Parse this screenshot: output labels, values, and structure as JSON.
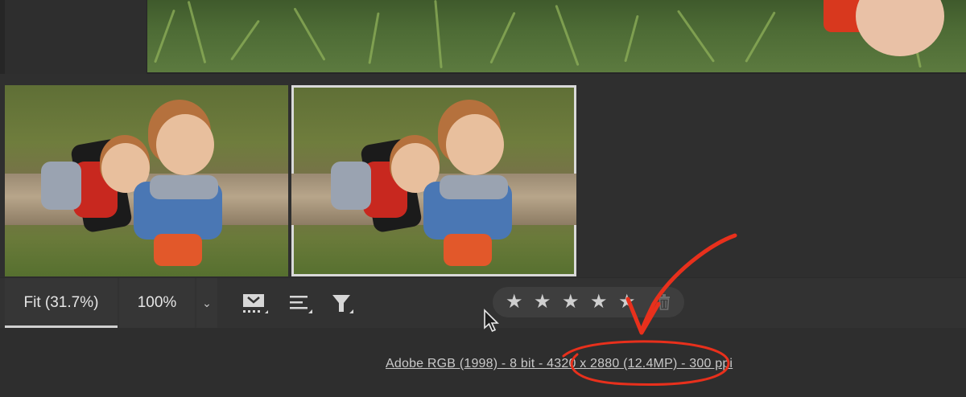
{
  "viewer": {
    "fit_label": "Fit (31.7%)",
    "zoom_label": "100%",
    "zoom_dropdown_icon": "chevron-down-icon"
  },
  "toolbar": {
    "icons": [
      "thumbnail-view-icon",
      "sort-icon",
      "filter-icon"
    ]
  },
  "rating": {
    "stars": 5,
    "delete_icon": "trash-icon"
  },
  "status": {
    "file_info": "Adobe RGB (1998) - 8 bit - 4320 x 2880 (12.4MP) - 300 ppi"
  },
  "colors": {
    "annotation": "#e8301c",
    "selection_border": "#d9d9d9"
  }
}
